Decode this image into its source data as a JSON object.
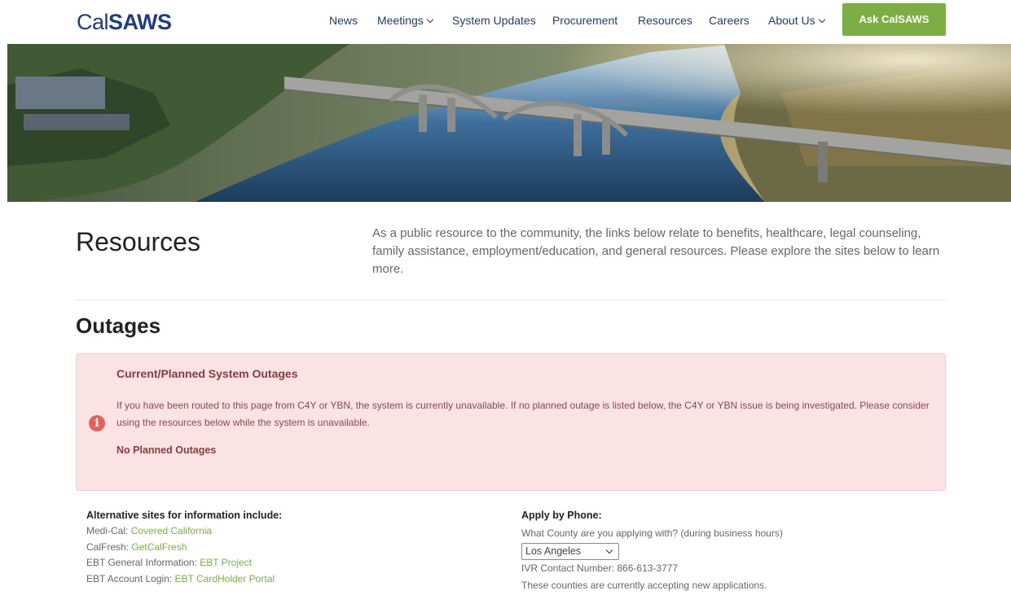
{
  "header": {
    "logo_light": "Cal",
    "logo_bold": "SAWS",
    "nav": [
      {
        "label": "News",
        "dropdown": false
      },
      {
        "label": "Meetings",
        "dropdown": true
      },
      {
        "label": "System Updates",
        "dropdown": false
      },
      {
        "label": "Procurement",
        "dropdown": false
      },
      {
        "label": "Resources",
        "dropdown": false
      },
      {
        "label": "Careers",
        "dropdown": false
      },
      {
        "label": "About Us",
        "dropdown": true
      }
    ],
    "cta_label": "Ask CalSAWS"
  },
  "intro": {
    "title": "Resources",
    "text": "As a public resource to the community, the links below relate to benefits, healthcare, legal counseling, family assistance, employment/education, and general resources. Please explore the sites below to learn more."
  },
  "outages": {
    "section_title": "Outages",
    "alert_title": "Current/Planned System Outages",
    "alert_body": "If you have been routed to this page from C4Y or YBN, the system is currently unavailable. If no planned outage is listed below, the C4Y or YBN issue is being investigated. Please consider using the resources below while the system is unavailable.",
    "alert_status": "No Planned Outages",
    "icon": "info-icon",
    "colors": {
      "alert_bg": "#fbe3e4",
      "alert_icon": "#e2635b"
    }
  },
  "alternatives": {
    "heading": "Alternative sites for information include:",
    "items": [
      {
        "label": "Medi-Cal:",
        "link": "Covered California"
      },
      {
        "label": "CalFresh:",
        "link": "GetCalFresh"
      },
      {
        "label": "EBT General Information:",
        "link": "EBT Project"
      },
      {
        "label": "EBT Account Login:",
        "link": "EBT CardHolder Portal"
      }
    ]
  },
  "phone": {
    "heading": "Apply by Phone:",
    "question": "What County are you applying with? (during business hours)",
    "county_selected": "Los Angeles",
    "ivr": "IVR Contact Number: 866-613-3777",
    "note": "These counties are currently accepting new applications."
  },
  "colors": {
    "brand": "#1f3a8a",
    "accent": "#7cae45"
  }
}
